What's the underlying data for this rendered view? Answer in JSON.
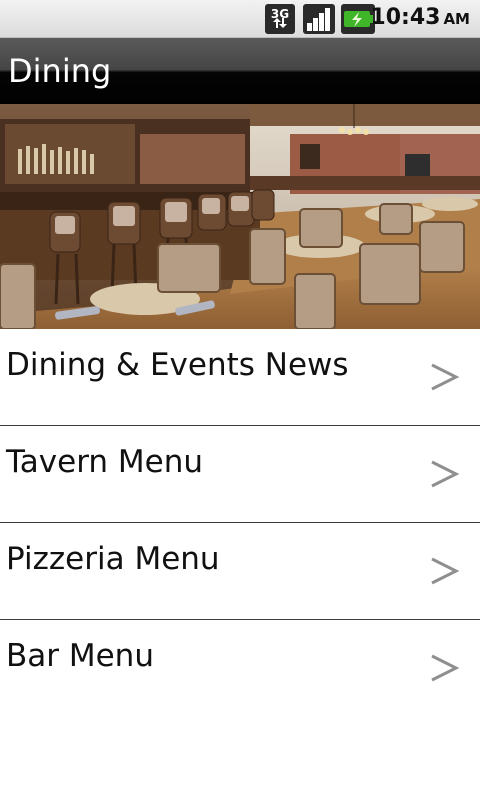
{
  "status_bar": {
    "network": "3G",
    "time": "10:43",
    "ampm": "AM",
    "icons": [
      "network-3g-icon",
      "signal-icon",
      "battery-charging-icon"
    ],
    "colors": {
      "battery": "#3fb52a"
    }
  },
  "header": {
    "title": "Dining"
  },
  "hero": {
    "description": "restaurant-interior-photo"
  },
  "menu": {
    "items": [
      {
        "label": "Dining & Events News"
      },
      {
        "label": "Tavern Menu"
      },
      {
        "label": "Pizzeria Menu"
      },
      {
        "label": "Bar Menu"
      }
    ]
  }
}
